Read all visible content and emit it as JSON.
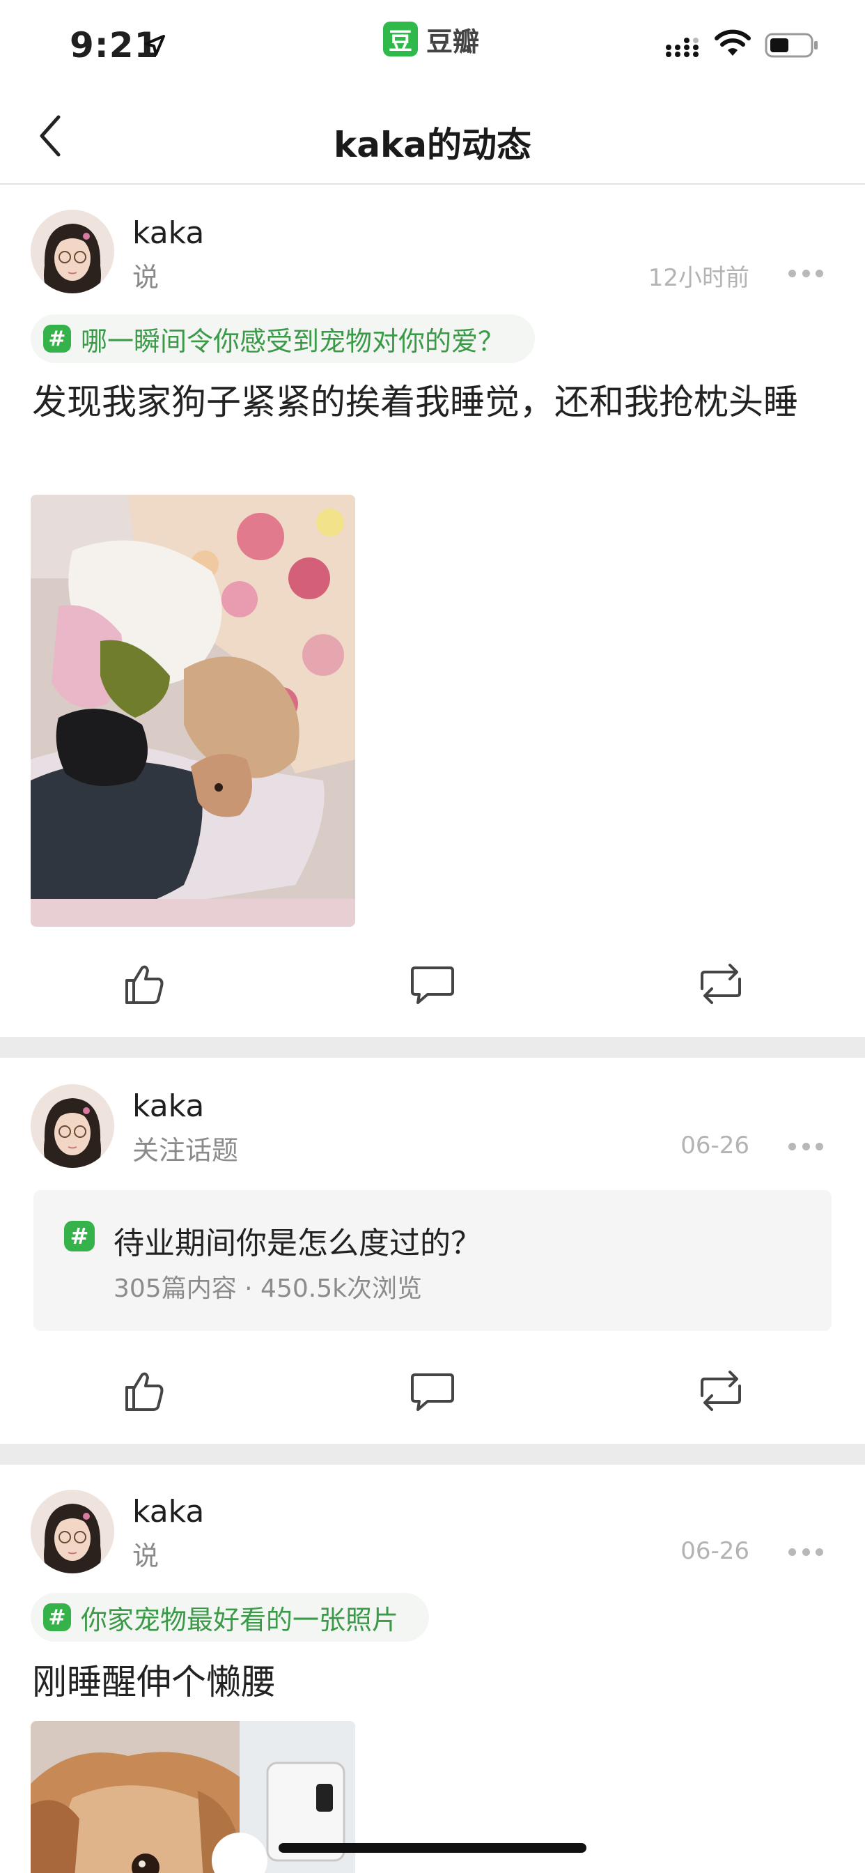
{
  "status_bar": {
    "time": "9:21",
    "app_logo_char": "豆",
    "app_name": "豆瓣"
  },
  "navbar": {
    "title": "kaka的动态"
  },
  "posts": [
    {
      "username": "kaka",
      "action": "说",
      "timestamp": "12小时前",
      "topic": "哪一瞬间令你感受到宠物对你的爱？",
      "text": "发现我家狗子紧紧的挨着我睡觉，还和我抢枕头睡"
    },
    {
      "username": "kaka",
      "action": "关注话题",
      "timestamp": "06-26",
      "topic_card": {
        "title": "待业期间你是怎么度过的？",
        "stats": "305篇内容 · 450.5k次浏览"
      }
    },
    {
      "username": "kaka",
      "action": "说",
      "timestamp": "06-26",
      "topic": "你家宠物最好看的一张照片",
      "text": "刚睡醒伸个懒腰"
    }
  ],
  "topic_hash_symbol": "#",
  "colors": {
    "accent_green": "#35b24a",
    "topic_text": "#3a9a48",
    "divider": "#ebebeb"
  }
}
